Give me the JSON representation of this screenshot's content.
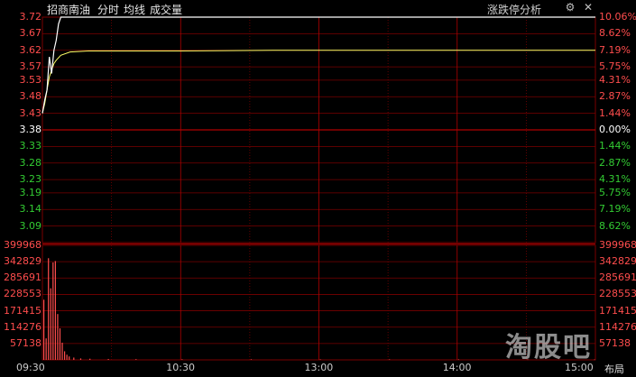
{
  "header": {
    "stock_name": "招商南油",
    "mode_label": "分时",
    "avg_label": "均线",
    "volume_label": "成交量",
    "limit_analysis": "涨跌停分析"
  },
  "icons": {
    "settings": "gear-icon",
    "close": "close-icon"
  },
  "layout_button": "布局",
  "watermark": "淘股吧",
  "colors": {
    "up": "#ff4d4d",
    "down": "#33cc33",
    "flat": "#ffffff",
    "grid": "#7a0000",
    "price_line": "#ffffff",
    "avg_line": "#ffff66"
  },
  "chart_data": {
    "type": "line",
    "price_axis": {
      "ticks": [
        {
          "label": "3.72",
          "pct": "10.06%",
          "dir": "up",
          "v": 3.72
        },
        {
          "label": "3.67",
          "pct": "8.62%",
          "dir": "up",
          "v": 3.67
        },
        {
          "label": "3.62",
          "pct": "7.19%",
          "dir": "up",
          "v": 3.62
        },
        {
          "label": "3.57",
          "pct": "5.75%",
          "dir": "up",
          "v": 3.57
        },
        {
          "label": "3.53",
          "pct": "4.31%",
          "dir": "up",
          "v": 3.53
        },
        {
          "label": "3.48",
          "pct": "2.87%",
          "dir": "up",
          "v": 3.48
        },
        {
          "label": "3.43",
          "pct": "1.44%",
          "dir": "up",
          "v": 3.43
        },
        {
          "label": "3.38",
          "pct": "0.00%",
          "dir": "flat",
          "v": 3.38
        },
        {
          "label": "3.33",
          "pct": "1.44%",
          "dir": "down",
          "v": 3.33
        },
        {
          "label": "3.28",
          "pct": "2.87%",
          "dir": "down",
          "v": 3.28
        },
        {
          "label": "3.23",
          "pct": "4.31%",
          "dir": "down",
          "v": 3.23
        },
        {
          "label": "3.19",
          "pct": "5.75%",
          "dir": "down",
          "v": 3.19
        },
        {
          "label": "3.14",
          "pct": "7.19%",
          "dir": "down",
          "v": 3.14
        },
        {
          "label": "3.09",
          "pct": "8.62%",
          "dir": "down",
          "v": 3.09
        }
      ],
      "ylim": [
        3.04,
        3.72
      ],
      "prev_close": 3.38
    },
    "volume_axis": {
      "ticks": [
        "399968",
        "342829",
        "285691",
        "228553",
        "171415",
        "114276",
        "57138"
      ],
      "ylim": [
        0,
        399968
      ]
    },
    "time_ticks": [
      "09:30",
      "10:30",
      "13:00",
      "14:00",
      "15:00"
    ],
    "total_minutes": 240,
    "price_series": [
      [
        0,
        3.43
      ],
      [
        1,
        3.47
      ],
      [
        2,
        3.5
      ],
      [
        3,
        3.6
      ],
      [
        4,
        3.55
      ],
      [
        5,
        3.62
      ],
      [
        6,
        3.65
      ],
      [
        7,
        3.7
      ],
      [
        8,
        3.72
      ],
      [
        9,
        3.72
      ],
      [
        10,
        3.72
      ],
      [
        240,
        3.72
      ]
    ],
    "avg_series": [
      [
        0,
        3.43
      ],
      [
        1,
        3.46
      ],
      [
        2,
        3.5
      ],
      [
        3,
        3.54
      ],
      [
        4,
        3.56
      ],
      [
        5,
        3.58
      ],
      [
        6,
        3.59
      ],
      [
        8,
        3.605
      ],
      [
        12,
        3.615
      ],
      [
        20,
        3.618
      ],
      [
        60,
        3.618
      ],
      [
        100,
        3.62
      ],
      [
        240,
        3.62
      ]
    ],
    "volume_series": [
      [
        0,
        210000
      ],
      [
        1,
        75000
      ],
      [
        2,
        355000
      ],
      [
        3,
        250000
      ],
      [
        4,
        340000
      ],
      [
        5,
        345000
      ],
      [
        6,
        160000
      ],
      [
        7,
        110000
      ],
      [
        8,
        60000
      ],
      [
        9,
        30000
      ],
      [
        10,
        18000
      ],
      [
        11,
        12000
      ],
      [
        13,
        8000
      ],
      [
        16,
        5000
      ],
      [
        20,
        4000
      ],
      [
        28,
        3000
      ],
      [
        40,
        2500
      ],
      [
        60,
        2000
      ],
      [
        90,
        2000
      ],
      [
        120,
        1800
      ],
      [
        150,
        1800
      ],
      [
        180,
        1800
      ],
      [
        210,
        1600
      ],
      [
        239,
        1500
      ]
    ]
  }
}
